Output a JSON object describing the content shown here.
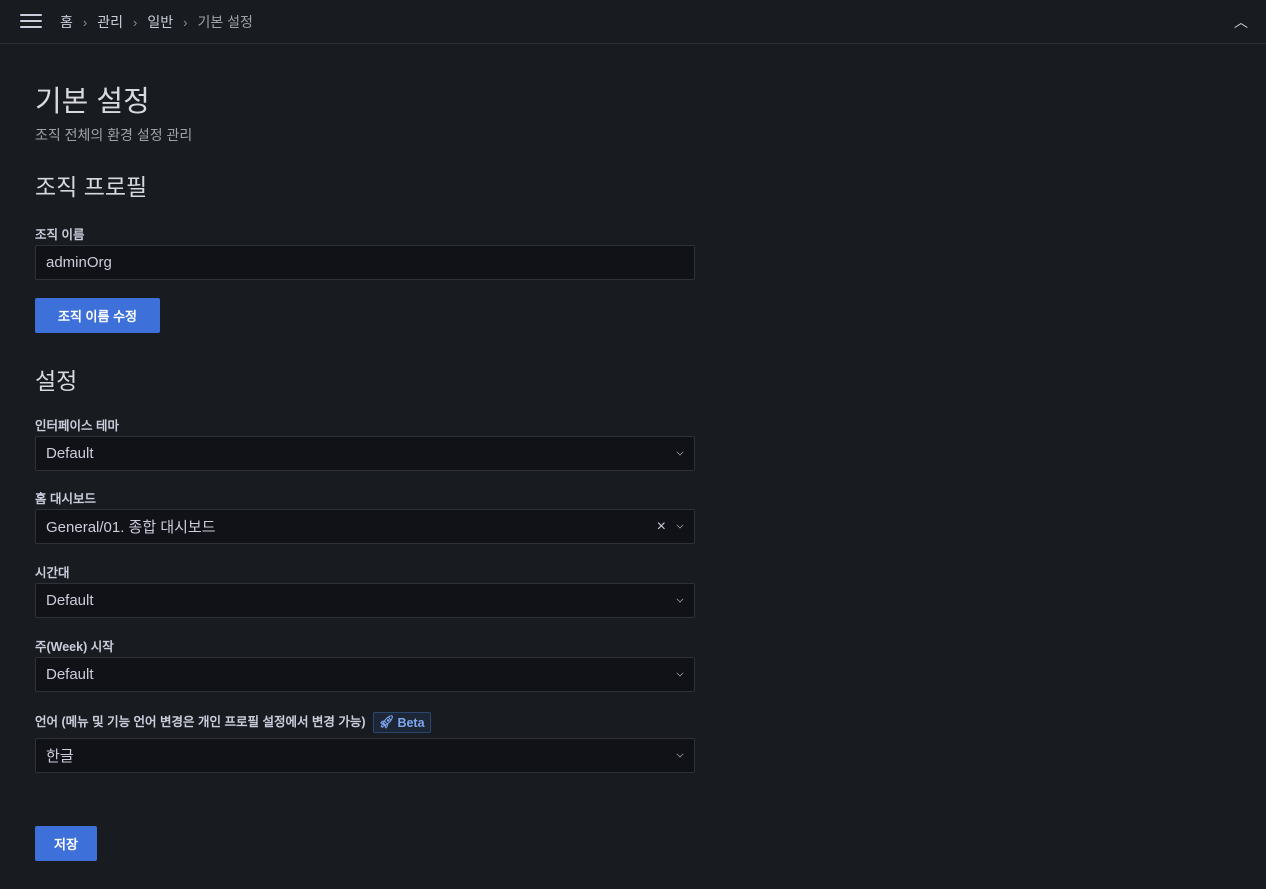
{
  "breadcrumb": [
    "홈",
    "관리",
    "일반",
    "기본 설정"
  ],
  "page": {
    "title": "기본 설정",
    "subtitle": "조직 전체의 환경 설정 관리"
  },
  "org_profile": {
    "heading": "조직 프로필",
    "name_label": "조직 이름",
    "name_value": "adminOrg",
    "update_button": "조직 이름 수정"
  },
  "settings": {
    "heading": "설정",
    "fields": [
      {
        "label": "인터페이스 테마",
        "value": "Default"
      },
      {
        "label": "홈 대시보드",
        "value": "General/01. 종합 대시보드"
      },
      {
        "label": "시간대",
        "value": "Default"
      },
      {
        "label": "주(Week) 시작",
        "value": "Default"
      },
      {
        "label": "언어 (메뉴 및 기능 언어 변경은 개인 프로필 설정에서 변경 가능)",
        "value": "한글",
        "badge": "Beta"
      }
    ],
    "save_button": "저장"
  },
  "colors": {
    "primary": "#3d71d9",
    "background": "#181b1f"
  }
}
